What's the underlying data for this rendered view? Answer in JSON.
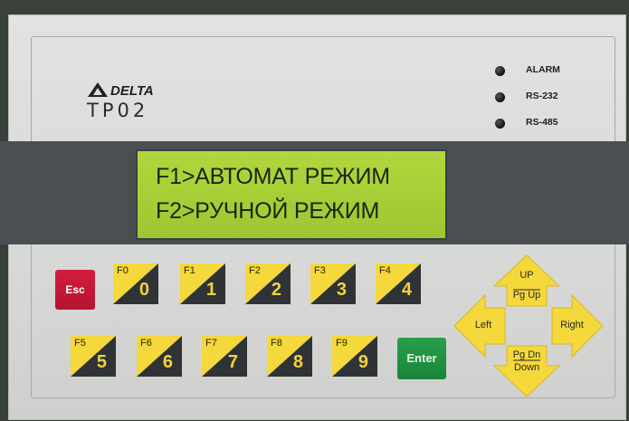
{
  "brand": "DELTA",
  "model": "TP02",
  "leds": [
    {
      "label": "ALARM"
    },
    {
      "label": "RS-232"
    },
    {
      "label": "RS-485"
    }
  ],
  "lcd": {
    "line1": "F1>АВТОМАТ РЕЖИМ",
    "line2": "F2>РУЧНОЙ РЕЖИМ"
  },
  "keys": {
    "esc": "Esc",
    "enter": "Enter",
    "row1": [
      {
        "fn": "F0",
        "num": "0"
      },
      {
        "fn": "F1",
        "num": "1"
      },
      {
        "fn": "F2",
        "num": "2"
      },
      {
        "fn": "F3",
        "num": "3"
      },
      {
        "fn": "F4",
        "num": "4"
      }
    ],
    "row2": [
      {
        "fn": "F5",
        "num": "5"
      },
      {
        "fn": "F6",
        "num": "6"
      },
      {
        "fn": "F7",
        "num": "7"
      },
      {
        "fn": "F8",
        "num": "8"
      },
      {
        "fn": "F9",
        "num": "9"
      }
    ]
  },
  "dpad": {
    "up_top": "UP",
    "up_bottom": "Pg Up",
    "left": "Left",
    "right": "Right",
    "down_top": "Pg Dn",
    "down_bottom": "Down"
  },
  "colors": {
    "lcd": "#a6cf36",
    "key_yellow": "#f4d83c",
    "key_dark": "#2f3336",
    "esc": "#c4173a",
    "enter": "#1e8f42"
  }
}
